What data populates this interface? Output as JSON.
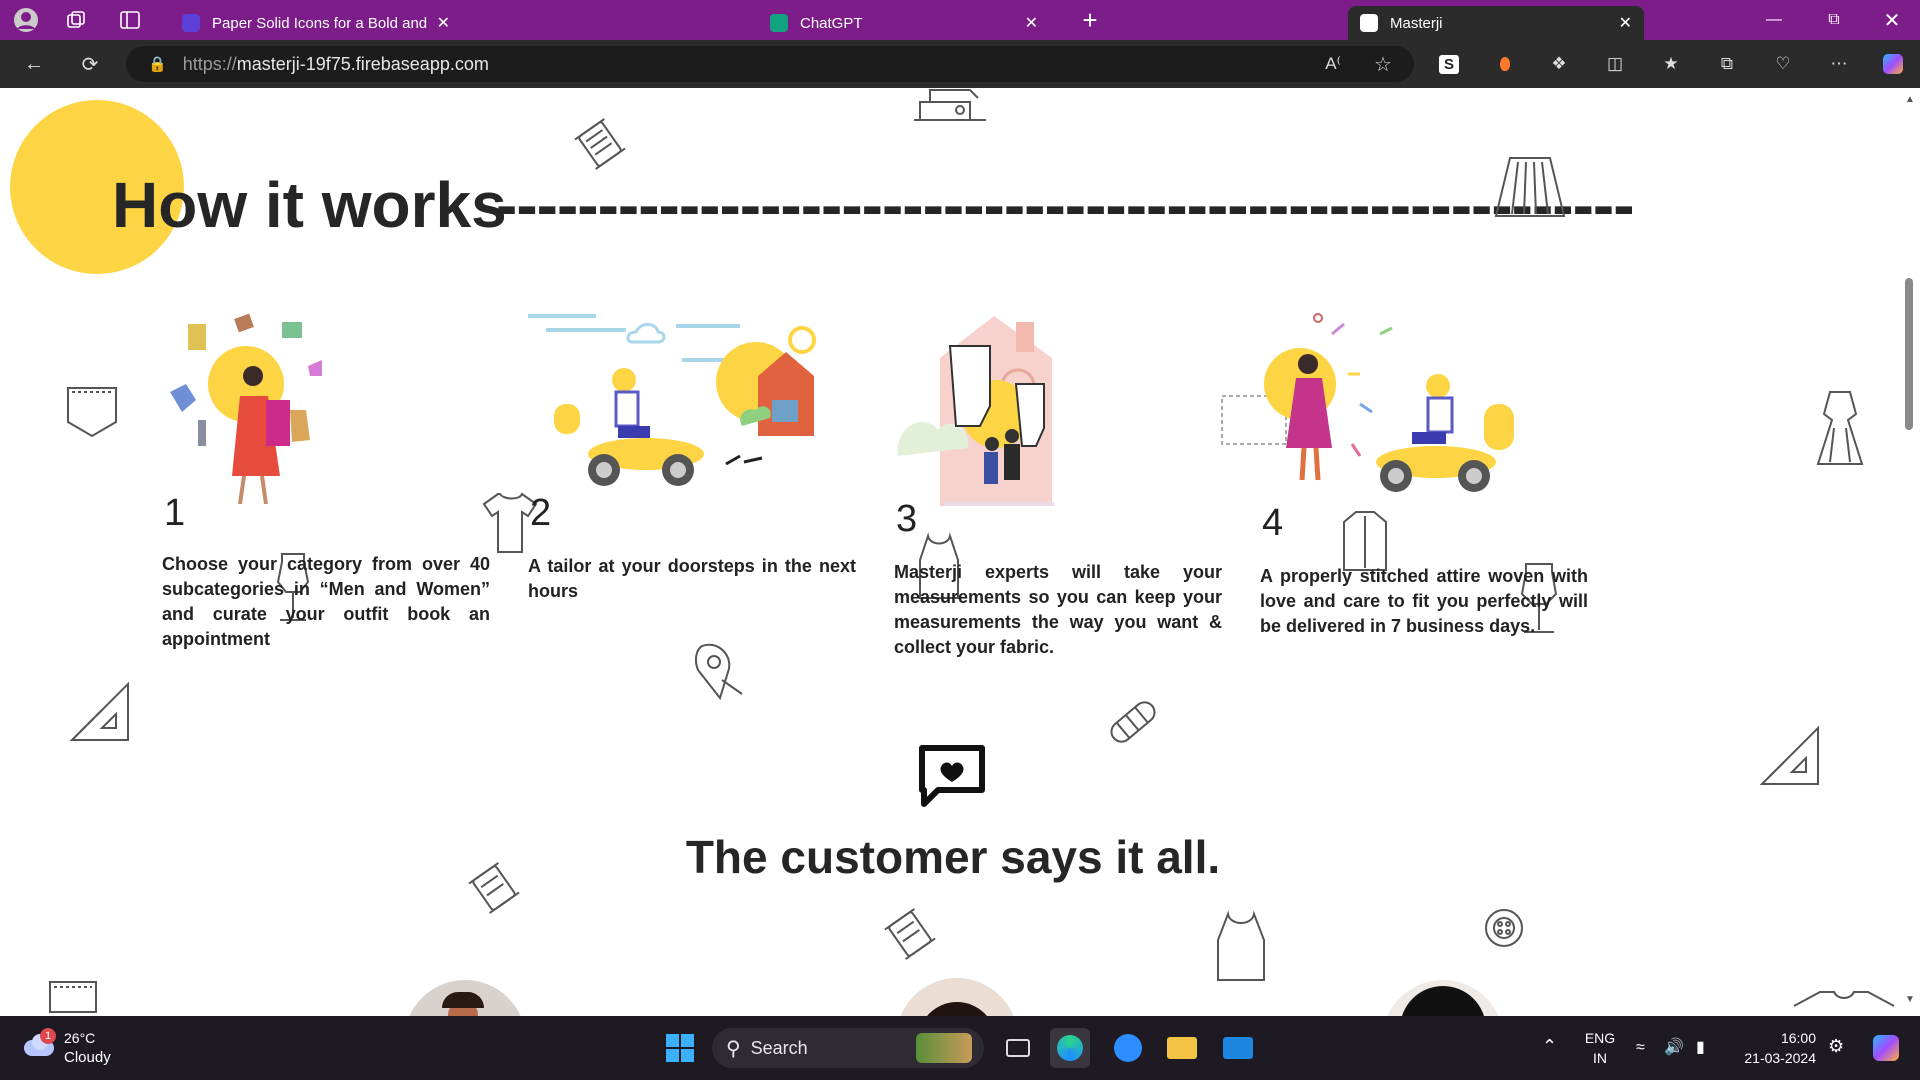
{
  "browser": {
    "tabs": [
      {
        "title": "Paper Solid Icons for a Bold and",
        "close": "✕"
      },
      {
        "title": "ChatGPT",
        "close": "✕"
      },
      {
        "title": "Masterji",
        "close": "✕"
      }
    ],
    "new_tab": "+",
    "url_prefix": "https://",
    "url_host": "masterji-19f75.firebaseapp.com",
    "accent": "#7c1d8a"
  },
  "page": {
    "how_title": "How it works",
    "how_dashes": "--------------------------------------------------------",
    "steps": [
      {
        "num": "1",
        "text": "Choose your category from over 40 subcategories in “Men and Women” and curate your outfit book an appointment"
      },
      {
        "num": "2",
        "text": "A tailor at your doorsteps in the next hours"
      },
      {
        "num": "3",
        "text": "Masterji experts will take your measurements so you can keep your measurements the way you want & collect your fabric."
      },
      {
        "num": "4",
        "text": "A properly stitched attire woven with love and care to fit you perfectly will be delivered in 7 business days."
      }
    ],
    "customer_title": "The customer says it all.",
    "accent_yellow": "#fdd544"
  },
  "taskbar": {
    "weather_temp": "26°C",
    "weather_desc": "Cloudy",
    "weather_badge": "1",
    "search_label": "Search",
    "lang_top": "ENG",
    "lang_bottom": "IN",
    "time": "16:00",
    "date": "21-03-2024"
  }
}
